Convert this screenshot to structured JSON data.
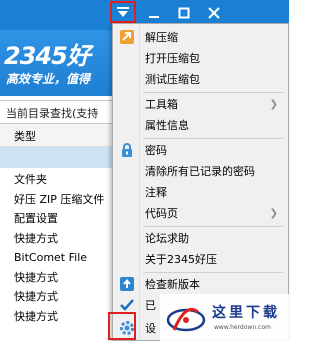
{
  "app": {
    "logo_text": "2345好",
    "slogan": "高效专业，值得",
    "search_placeholder": "当前目录查找(支持",
    "column_type": "类型"
  },
  "file_types": [
    "文件夹",
    "好压 ZIP 压缩文件",
    "配置设置",
    "快捷方式",
    "BitComet File",
    "快捷方式",
    "快捷方式",
    "快捷方式"
  ],
  "menu": {
    "items": [
      {
        "label": "解压缩",
        "icon": "extract-icon"
      },
      {
        "label": "打开压缩包"
      },
      {
        "label": "测试压缩包"
      },
      {
        "label": "工具箱",
        "submenu": true
      },
      {
        "label": "属性信息"
      },
      {
        "label": "密码",
        "icon": "lock-icon"
      },
      {
        "label": "清除所有已记录的密码"
      },
      {
        "label": "注释"
      },
      {
        "label": "代码页",
        "submenu": true
      },
      {
        "label": "论坛求助"
      },
      {
        "label": "关于2345好压"
      },
      {
        "label": "检查新版本",
        "icon": "update-icon"
      },
      {
        "label": "已",
        "icon": "checkmark-icon"
      },
      {
        "label": "设",
        "icon": "settings-gear-icon"
      }
    ]
  },
  "watermark": {
    "title": "这里下载",
    "url": "www.herdown.com"
  },
  "colors": {
    "titlebar": "#1a80d4",
    "highlight_border": "#e02020",
    "selection": "#cfe3f7"
  }
}
